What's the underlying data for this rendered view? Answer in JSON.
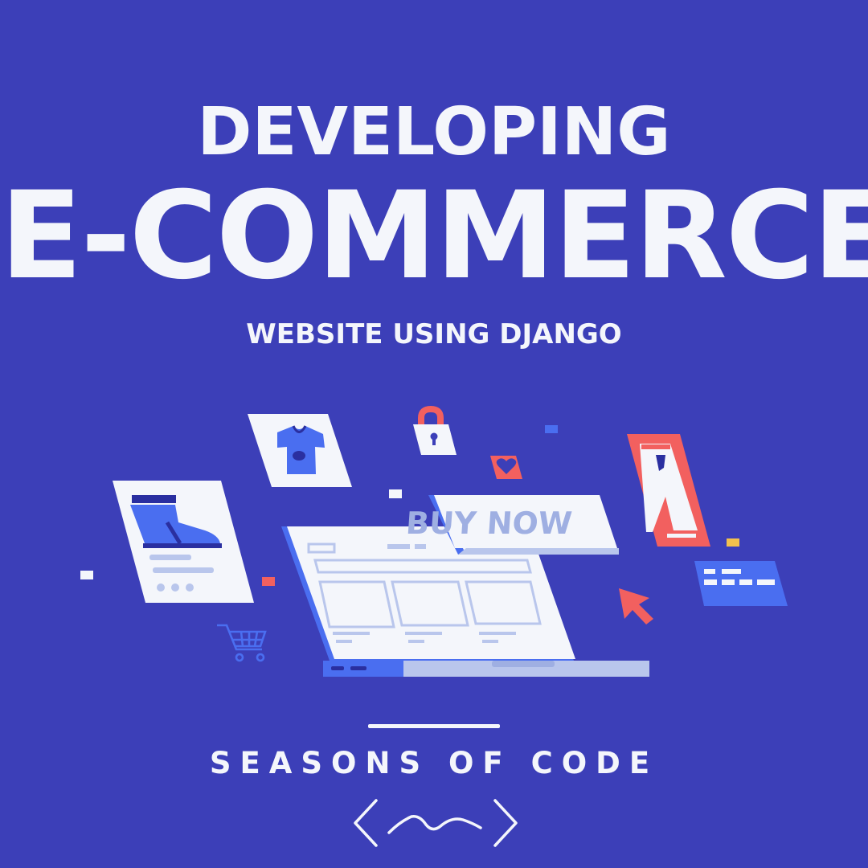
{
  "poster": {
    "line1": "DEVELOPING",
    "line2": "E-COMMERCE",
    "line3": "WEBSITE USING DJANGO"
  },
  "illustration": {
    "buy_button_label": "BUY NOW",
    "icons": [
      "tshirt-icon",
      "sneaker-icon",
      "padlock-icon",
      "heart-icon",
      "pants-icon",
      "credit-card-icon",
      "shopping-cart-icon",
      "cursor-arrow-icon",
      "laptop-icon"
    ]
  },
  "footer": {
    "brand": "SEASONS OF CODE",
    "logo": "code-brackets-wave-logo"
  },
  "colors": {
    "background": "#3c3fb8",
    "text": "#f4f6fb",
    "accent_blue": "#4a6ef0",
    "accent_red": "#f2605f",
    "accent_yellow": "#f2c14e",
    "light_blue": "#b9c6ec"
  }
}
